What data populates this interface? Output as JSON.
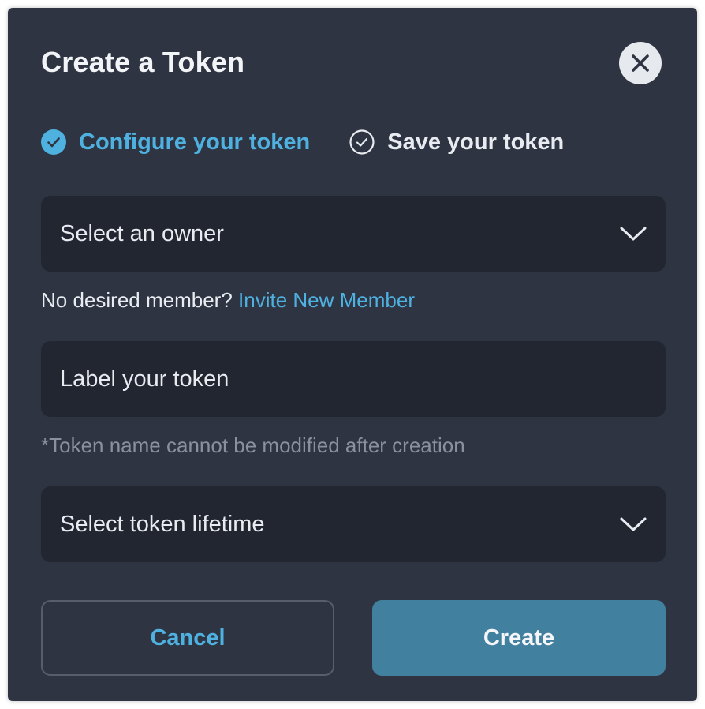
{
  "dialog": {
    "title": "Create a Token",
    "close_icon": "close-icon"
  },
  "steps": [
    {
      "label": "Configure your token",
      "state": "active",
      "icon": "check-circle-filled-icon"
    },
    {
      "label": "Save your token",
      "state": "inactive",
      "icon": "check-circle-outline-icon"
    }
  ],
  "owner_select": {
    "placeholder": "Select an owner",
    "icon": "chevron-down-icon"
  },
  "member_help": {
    "text": "No desired member?",
    "link": "Invite New Member"
  },
  "label_input": {
    "placeholder": "Label your token",
    "value": ""
  },
  "label_note": "*Token name cannot be modified after creation",
  "lifetime_select": {
    "placeholder": "Select token lifetime",
    "icon": "chevron-down-icon"
  },
  "actions": {
    "cancel_label": "Cancel",
    "create_label": "Create"
  },
  "colors": {
    "background": "#2e3442",
    "field": "#222631",
    "accent": "#4eb1e0",
    "primary_button": "#42809f"
  }
}
